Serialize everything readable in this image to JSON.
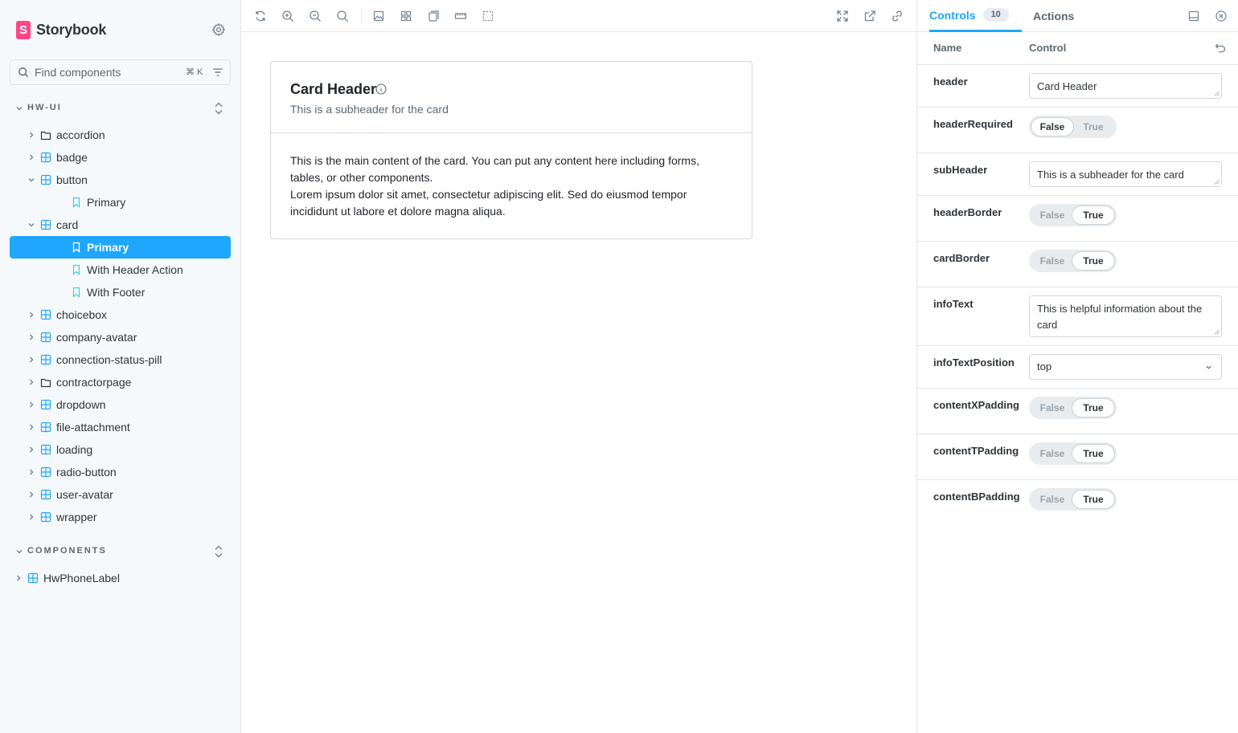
{
  "sidebar": {
    "brand": "Storybook",
    "search_placeholder": "Find components",
    "search_shortcut": "⌘ K",
    "sections": [
      {
        "label": "HW-UI"
      },
      {
        "label": "COMPONENTS"
      }
    ],
    "tree": [
      {
        "label": "accordion",
        "kind": "folder",
        "expanded": false
      },
      {
        "label": "badge",
        "kind": "component",
        "expanded": false
      },
      {
        "label": "button",
        "kind": "component",
        "expanded": true
      },
      {
        "label": "Primary",
        "kind": "story"
      },
      {
        "label": "card",
        "kind": "component",
        "expanded": true
      },
      {
        "label": "Primary",
        "kind": "story",
        "selected": true
      },
      {
        "label": "With Header Action",
        "kind": "story"
      },
      {
        "label": "With Footer",
        "kind": "story"
      },
      {
        "label": "choicebox",
        "kind": "component",
        "expanded": false
      },
      {
        "label": "company-avatar",
        "kind": "component",
        "expanded": false
      },
      {
        "label": "connection-status-pill",
        "kind": "component",
        "expanded": false
      },
      {
        "label": "contractorpage",
        "kind": "folder",
        "expanded": false
      },
      {
        "label": "dropdown",
        "kind": "component",
        "expanded": false
      },
      {
        "label": "file-attachment",
        "kind": "component",
        "expanded": false
      },
      {
        "label": "loading",
        "kind": "component",
        "expanded": false
      },
      {
        "label": "radio-button",
        "kind": "component",
        "expanded": false
      },
      {
        "label": "user-avatar",
        "kind": "component",
        "expanded": false
      },
      {
        "label": "wrapper",
        "kind": "component",
        "expanded": false
      },
      {
        "label": "HwPhoneLabel",
        "kind": "component",
        "expanded": false
      }
    ]
  },
  "toolbar": {
    "icons": [
      "reload-icon",
      "zoom-in-icon",
      "zoom-out-icon",
      "zoom-reset-icon",
      "background-icon",
      "grid-icon",
      "viewport-icon",
      "measure-icon",
      "outline-icon",
      "fullscreen-icon",
      "open-new-tab-icon",
      "copy-link-icon"
    ]
  },
  "card": {
    "title": "Card Header",
    "subheader": "This is a subheader for the card",
    "body_line1": "This is the main content of the card. You can put any content here including forms, tables, or other components.",
    "body_line2": "Lorem ipsum dolor sit amet, consectetur adipiscing elit. Sed do eiusmod tempor incididunt ut labore et dolore magna aliqua."
  },
  "panel": {
    "tab_controls": "Controls",
    "tab_controls_count": "10",
    "tab_actions": "Actions",
    "col_name": "Name",
    "col_control": "Control",
    "toggle_false": "False",
    "toggle_true": "True",
    "rows": {
      "header": {
        "name": "header",
        "value": "Card Header"
      },
      "headerRequired": {
        "name": "headerRequired",
        "value": "False"
      },
      "subHeader": {
        "name": "subHeader",
        "value": "This is a subheader for the card"
      },
      "headerBorder": {
        "name": "headerBorder",
        "value": "True"
      },
      "cardBorder": {
        "name": "cardBorder",
        "value": "True"
      },
      "infoText": {
        "name": "infoText",
        "value": "This is helpful information about the card"
      },
      "infoTextPosition": {
        "name": "infoTextPosition",
        "value": "top"
      },
      "contentXPadding": {
        "name": "contentXPadding",
        "value": "True"
      },
      "contentTPadding": {
        "name": "contentTPadding",
        "value": "True"
      },
      "contentBPadding": {
        "name": "contentBPadding",
        "value": "True"
      }
    }
  },
  "colors": {
    "accent": "#1ea7fd",
    "brand": "#ff4785",
    "sidebar_bg": "#f6f9fc"
  }
}
